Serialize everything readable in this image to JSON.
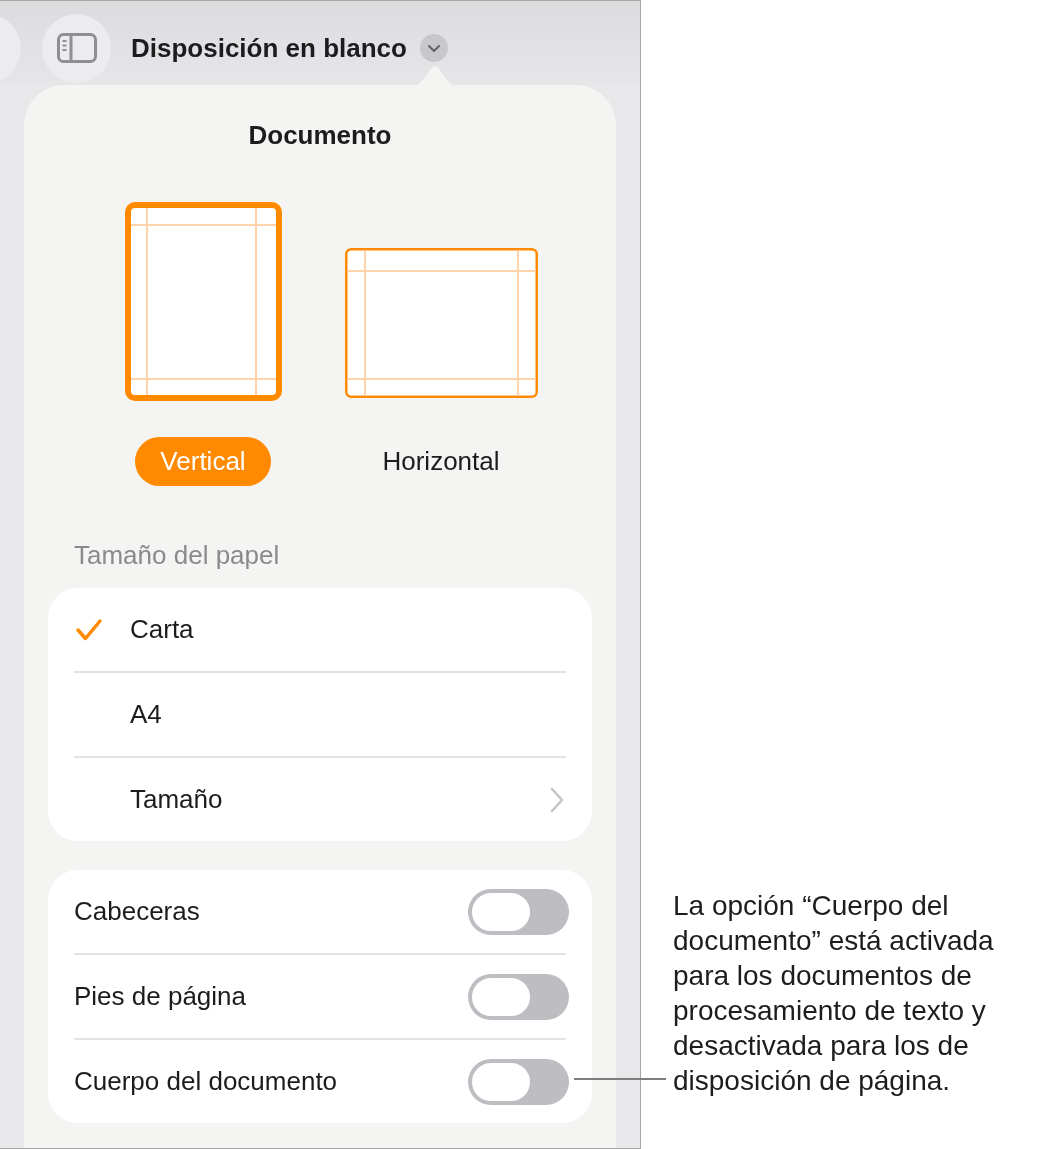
{
  "toolbar": {
    "title": "Disposición en blanco"
  },
  "popover": {
    "title": "Documento",
    "orientations": [
      {
        "kind": "portrait",
        "label": "Vertical",
        "selected": true
      },
      {
        "kind": "landscape",
        "label": "Horizontal",
        "selected": false
      }
    ],
    "paper_size": {
      "heading": "Tamaño del papel",
      "options": [
        {
          "kind": "choice",
          "label": "Carta",
          "selected": true
        },
        {
          "kind": "choice",
          "label": "A4",
          "selected": false
        },
        {
          "kind": "submenu",
          "label": "Tamaño",
          "selected": false
        }
      ]
    },
    "switches": [
      {
        "label": "Cabeceras",
        "on": false
      },
      {
        "label": "Pies de página",
        "on": false
      },
      {
        "label": "Cuerpo del documento",
        "on": false
      }
    ]
  },
  "callout": {
    "text": "La opción “Cuerpo del documento” está activada para los documentos de procesamiento de texto y desactivada para los de disposición de página."
  }
}
